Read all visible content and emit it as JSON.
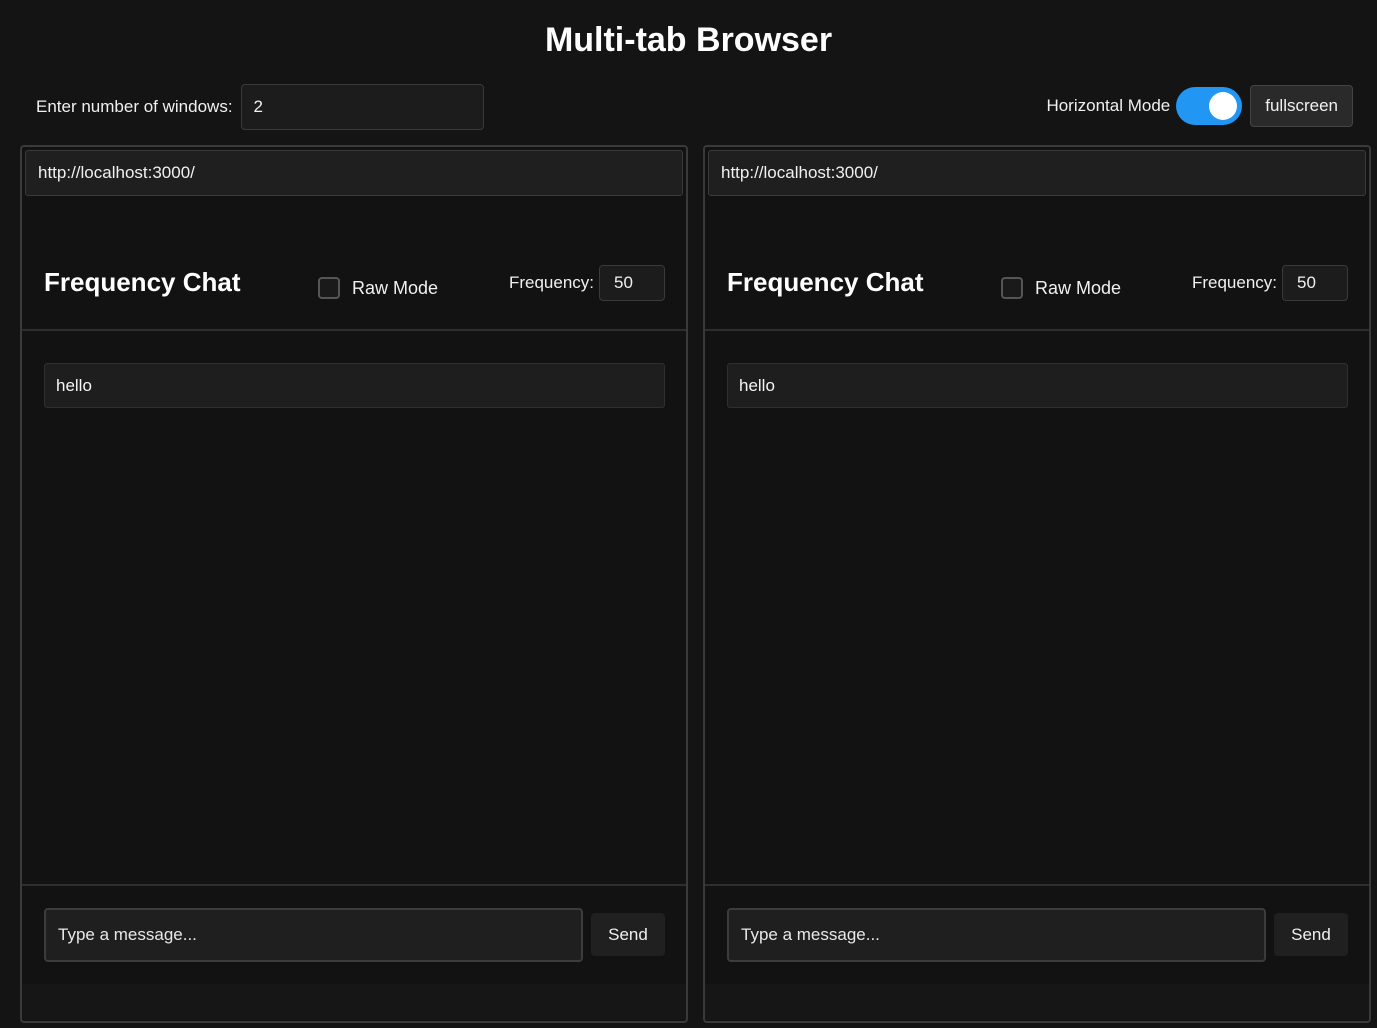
{
  "header": {
    "title": "Multi-tab Browser",
    "windows_label": "Enter number of windows:",
    "windows_value": "2",
    "horizontal_mode_label": "Horizontal Mode",
    "horizontal_mode_on": true,
    "fullscreen_label": "fullscreen"
  },
  "colors": {
    "toggle_on": "#2196f3",
    "background": "#141414"
  },
  "windows": [
    {
      "url": "http://localhost:3000/",
      "app_title": "Frequency Chat",
      "raw_mode_label": "Raw Mode",
      "raw_mode_checked": false,
      "frequency_label": "Frequency:",
      "frequency_value": "50",
      "messages": [
        "hello"
      ],
      "input_placeholder": "Type a message...",
      "send_label": "Send"
    },
    {
      "url": "http://localhost:3000/",
      "app_title": "Frequency Chat",
      "raw_mode_label": "Raw Mode",
      "raw_mode_checked": false,
      "frequency_label": "Frequency:",
      "frequency_value": "50",
      "messages": [
        "hello"
      ],
      "input_placeholder": "Type a message...",
      "send_label": "Send"
    }
  ]
}
